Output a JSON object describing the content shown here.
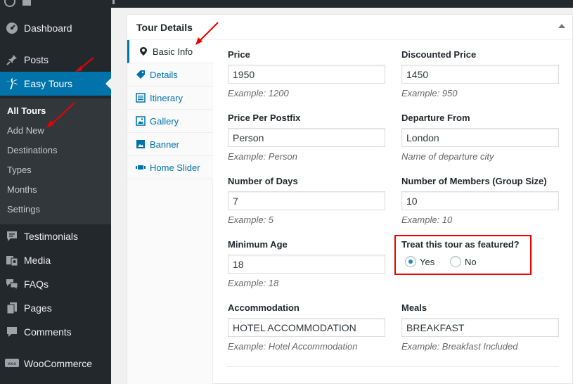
{
  "sidebar": {
    "menu": [
      {
        "label": "Dashboard",
        "icon": "dashboard-icon"
      },
      {
        "label": "Posts",
        "icon": "pin-icon"
      },
      {
        "label": "Easy Tours",
        "icon": "palm-tree-icon"
      },
      {
        "label": "Testimonials",
        "icon": "testimonial-icon"
      },
      {
        "label": "Media",
        "icon": "media-icon"
      },
      {
        "label": "FAQs",
        "icon": "faq-icon"
      },
      {
        "label": "Pages",
        "icon": "pages-icon"
      },
      {
        "label": "Comments",
        "icon": "comments-icon"
      },
      {
        "label": "WooCommerce",
        "icon": "woocommerce-icon"
      }
    ],
    "submenu": [
      "All Tours",
      "Add New",
      "Destinations",
      "Types",
      "Months",
      "Settings"
    ]
  },
  "postbox": {
    "title": "Tour Details",
    "tabs": [
      {
        "label": "Basic Info",
        "icon": "location-pin-icon"
      },
      {
        "label": "Details",
        "icon": "tag-icon"
      },
      {
        "label": "Itinerary",
        "icon": "list-icon"
      },
      {
        "label": "Gallery",
        "icon": "gallery-icon"
      },
      {
        "label": "Banner",
        "icon": "image-icon"
      },
      {
        "label": "Home Slider",
        "icon": "slider-icon"
      }
    ]
  },
  "fields": {
    "price": {
      "label": "Price",
      "value": "1950",
      "hint": "Example: 1200"
    },
    "discounted_price": {
      "label": "Discounted Price",
      "value": "1450",
      "hint": "Example: 950"
    },
    "price_postfix": {
      "label": "Price Per Postfix",
      "value": "Person",
      "hint": "Example: Person"
    },
    "departure_from": {
      "label": "Departure From",
      "value": "London",
      "hint": "Name of departure city"
    },
    "number_of_days": {
      "label": "Number of Days",
      "value": "7",
      "hint": "Example: 5"
    },
    "number_of_members": {
      "label": "Number of Members (Group Size)",
      "value": "10",
      "hint": "Example: 10"
    },
    "minimum_age": {
      "label": "Minimum Age",
      "value": "18",
      "hint": "Example: 18"
    },
    "accommodation": {
      "label": "Accommodation",
      "value": "HOTEL ACCOMMODATION",
      "hint": "Example: Hotel Accommodation"
    },
    "meals": {
      "label": "Meals",
      "value": "BREAKFAST",
      "hint": "Example: Breakfast Included"
    }
  },
  "featured": {
    "label": "Treat this tour as featured?",
    "options": [
      {
        "label": "Yes",
        "checked": true
      },
      {
        "label": "No",
        "checked": false
      }
    ]
  },
  "colors": {
    "accent": "#0073aa",
    "sidebar": "#23282d",
    "annotation": "#ee0000"
  }
}
